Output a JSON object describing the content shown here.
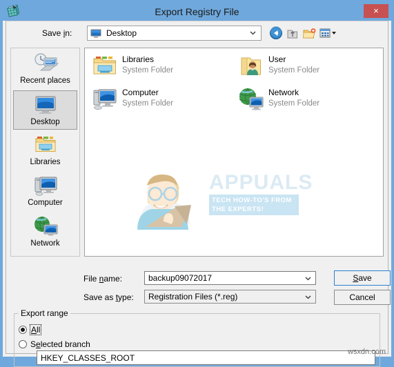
{
  "window": {
    "title": "Export Registry File",
    "icon": "registry-editor-icon",
    "close_label": "×",
    "titlebar_color": "#6fa8dc",
    "close_color": "#c75050"
  },
  "toolbar": {
    "save_in_label": "Save in:",
    "save_in_value": "Desktop",
    "save_in_icon": "desktop-icon",
    "buttons": [
      {
        "name": "back-button",
        "icon": "back-arrow-icon"
      },
      {
        "name": "up-one-level-button",
        "icon": "up-folder-icon"
      },
      {
        "name": "new-folder-button",
        "icon": "new-folder-icon"
      },
      {
        "name": "views-button",
        "icon": "views-grid-icon"
      }
    ]
  },
  "places": [
    {
      "label": "Recent places",
      "icon": "recent-places-icon",
      "selected": false
    },
    {
      "label": "Desktop",
      "icon": "desktop-icon",
      "selected": true
    },
    {
      "label": "Libraries",
      "icon": "libraries-folder-icon",
      "selected": false
    },
    {
      "label": "Computer",
      "icon": "computer-icon",
      "selected": false
    },
    {
      "label": "Network",
      "icon": "network-globe-icon",
      "selected": false
    }
  ],
  "files": [
    {
      "name": "Libraries",
      "type": "System Folder",
      "icon": "libraries-folder-icon"
    },
    {
      "name": "User",
      "type": "System Folder",
      "icon": "user-folder-icon"
    },
    {
      "name": "Computer",
      "type": "System Folder",
      "icon": "computer-icon"
    },
    {
      "name": "Network",
      "type": "System Folder",
      "icon": "network-globe-icon"
    }
  ],
  "watermark": {
    "brand": "APPUALS",
    "tagline_line1": "TECH HOW-TO'S FROM",
    "tagline_line2": "THE EXPERTS!",
    "brand_color": "#cfe3f0",
    "tag_color": "#b8dcef"
  },
  "fields": {
    "file_name_label": "File name:",
    "file_name_value": "backup09072017",
    "save_as_type_label": "Save as type:",
    "save_as_type_value": "Registration Files (*.reg)"
  },
  "buttons": {
    "save": "Save",
    "cancel": "Cancel"
  },
  "export_range": {
    "legend": "Export range",
    "all_label": "All",
    "all_selected": true,
    "selected_branch_label": "Selected branch",
    "selected_branch_selected": false,
    "branch_value": "HKEY_CLASSES_ROOT"
  },
  "site_watermark": "wsxdn.com"
}
